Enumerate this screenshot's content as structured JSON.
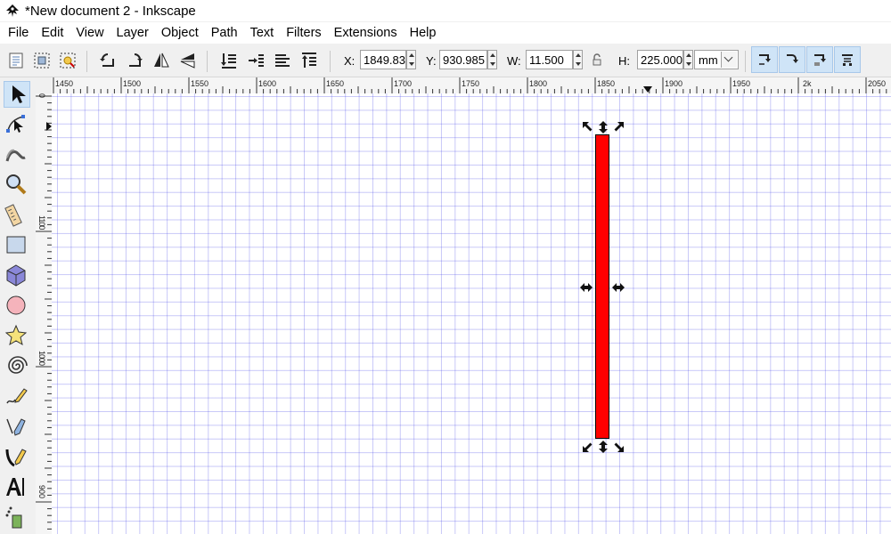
{
  "window": {
    "title": "*New document 2 - Inkscape",
    "icon": "inkscape-logo-icon"
  },
  "menu": [
    "File",
    "Edit",
    "View",
    "Layer",
    "Object",
    "Path",
    "Text",
    "Filters",
    "Extensions",
    "Help"
  ],
  "toolbar": {
    "icons": [
      "select-all-icon",
      "select-all-layers-icon",
      "deselect-icon",
      "rotate-ccw-icon",
      "rotate-cw-icon",
      "flip-horizontal-icon",
      "flip-vertical-icon",
      "lower-to-bottom-icon",
      "lower-icon",
      "raise-icon",
      "raise-to-top-icon"
    ],
    "x_label": "X:",
    "x_value": "1849.83",
    "y_label": "Y:",
    "y_value": "930.985",
    "w_label": "W:",
    "w_value": "11.500",
    "h_label": "H:",
    "h_value": "225.000",
    "unit": "mm",
    "transform_icons": [
      "scale-stroke-icon",
      "scale-corners-icon",
      "transform-gradients-icon",
      "transform-patterns-icon"
    ]
  },
  "tools": [
    "selector-tool-icon",
    "node-tool-icon",
    "tweak-tool-icon",
    "zoom-tool-icon",
    "measure-tool-icon",
    "rectangle-tool-icon",
    "3d-box-tool-icon",
    "ellipse-tool-icon",
    "star-tool-icon",
    "spiral-tool-icon",
    "pencil-tool-icon",
    "pen-tool-icon",
    "calligraphy-tool-icon",
    "text-tool-icon",
    "spray-tool-icon"
  ],
  "ruler_top_labels": [
    "1450",
    "1500",
    "1550",
    "1600",
    "1650",
    "1700",
    "1750",
    "1800",
    "1850",
    "1900",
    "1950",
    "2k",
    "2050"
  ],
  "ruler_left_labels": [
    "0",
    "1100",
    "1000",
    "900"
  ],
  "colors": {
    "selected_object_fill": "#ff0000",
    "grid": "#3c3ce6",
    "accent": "#cfe4f7"
  }
}
